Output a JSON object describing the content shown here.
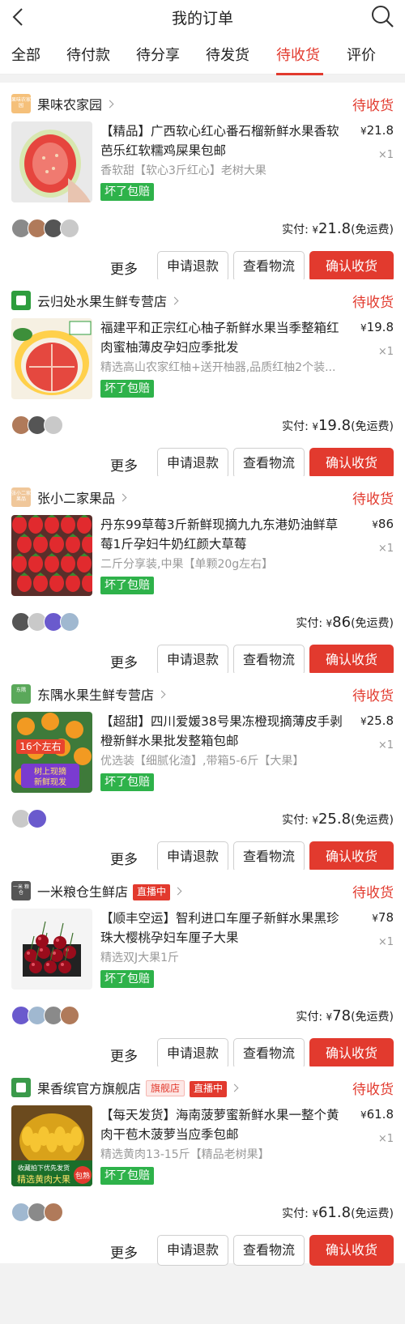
{
  "header": {
    "title": "我的订单"
  },
  "tabs": [
    "全部",
    "待付款",
    "待分享",
    "待发货",
    "待收货",
    "评价"
  ],
  "active_tab": "待收货",
  "labels": {
    "paid_prefix": "实付: ",
    "currency": "¥",
    "free_shipping": "(免运费)",
    "more": "更多",
    "refund": "申请退款",
    "logistics": "查看物流",
    "confirm": "确认收货",
    "live": "直播中",
    "flagship": "旗舰店"
  },
  "orders": [
    {
      "store": "果味农家园",
      "status": "待收货",
      "logo_color": "#f5c07a",
      "logo_text": "果味农家园",
      "title": "【精品】广西软心红心番石榴新鲜水果香软芭乐红软糯鸡屎果包邮",
      "sku": "香软甜【软心3斤红心】老树大果",
      "badge": "坏了包赔",
      "price": "21.8",
      "qty": "×1",
      "paid": "21.8",
      "avatars": 4,
      "image": "guava",
      "flags": []
    },
    {
      "store": "云归处水果生鲜专营店",
      "status": "待收货",
      "logo_color": "#2e9d3e",
      "logo_text": "",
      "title": "福建平和正宗红心柚子新鲜水果当季整箱红肉蜜柚薄皮孕妇应季批发",
      "sku": "精选高山农家红柚+送开柚器,品质红柚2个装...",
      "badge": "坏了包赔",
      "price": "19.8",
      "qty": "×1",
      "paid": "19.8",
      "avatars": 3,
      "image": "pomelo",
      "flags": []
    },
    {
      "store": "张小二家果品",
      "status": "待收货",
      "logo_color": "#f0c79a",
      "logo_text": "张小二家果品",
      "title": "丹东99草莓3斤新鲜现摘九九东港奶油鲜草莓1斤孕妇牛奶红颜大草莓",
      "sku": "二斤分享装,中果【单颗20g左右】",
      "badge": "坏了包赔",
      "price": "86",
      "qty": "×1",
      "paid": "86",
      "avatars": 4,
      "image": "strawberry",
      "flags": []
    },
    {
      "store": "东隅水果生鲜专营店",
      "status": "待收货",
      "logo_color": "#5aa85a",
      "logo_text": "东隅",
      "title": "【超甜】四川爱媛38号果冻橙现摘薄皮手剥橙新鲜水果批发整箱包邮",
      "sku": "优选装【细腻化渣】,带箱5-6斤【大果】",
      "badge": "坏了包赔",
      "price": "25.8",
      "qty": "×1",
      "paid": "25.8",
      "avatars": 2,
      "image": "orange",
      "image_text": [
        "16个左右",
        "树上现摘",
        "新鲜现发"
      ],
      "flags": []
    },
    {
      "store": "一米粮仓生鲜店",
      "status": "待收货",
      "logo_color": "#555555",
      "logo_text": "一米 粮仓",
      "title": "【顺丰空运】智利进口车厘子新鲜水果黑珍珠大樱桃孕妇车厘子大果",
      "sku": "精选双J大果1斤",
      "badge": "坏了包赔",
      "price": "78",
      "qty": "×1",
      "paid": "78",
      "avatars": 4,
      "image": "cherry",
      "flags": [
        "live"
      ]
    },
    {
      "store": "果香缤官方旗舰店",
      "status": "待收货",
      "logo_color": "#3a9a4a",
      "logo_text": "",
      "title": "【每天发货】海南菠萝蜜新鲜水果一整个黄肉干苞木菠萝当应季包邮",
      "sku": "精选黄肉13-15斤【精品老树果】",
      "badge": "坏了包赔",
      "price": "61.8",
      "qty": "×1",
      "paid": "61.8",
      "avatars": 3,
      "image": "jackfruit",
      "image_text": [
        "收藏拍下优先发货",
        "精选黄肉大果",
        "包熟"
      ],
      "flags": [
        "flagship",
        "live"
      ]
    }
  ],
  "colors": {
    "accent": "#e23a2e",
    "badge_green": "#2eb24a",
    "muted": "#999999"
  }
}
